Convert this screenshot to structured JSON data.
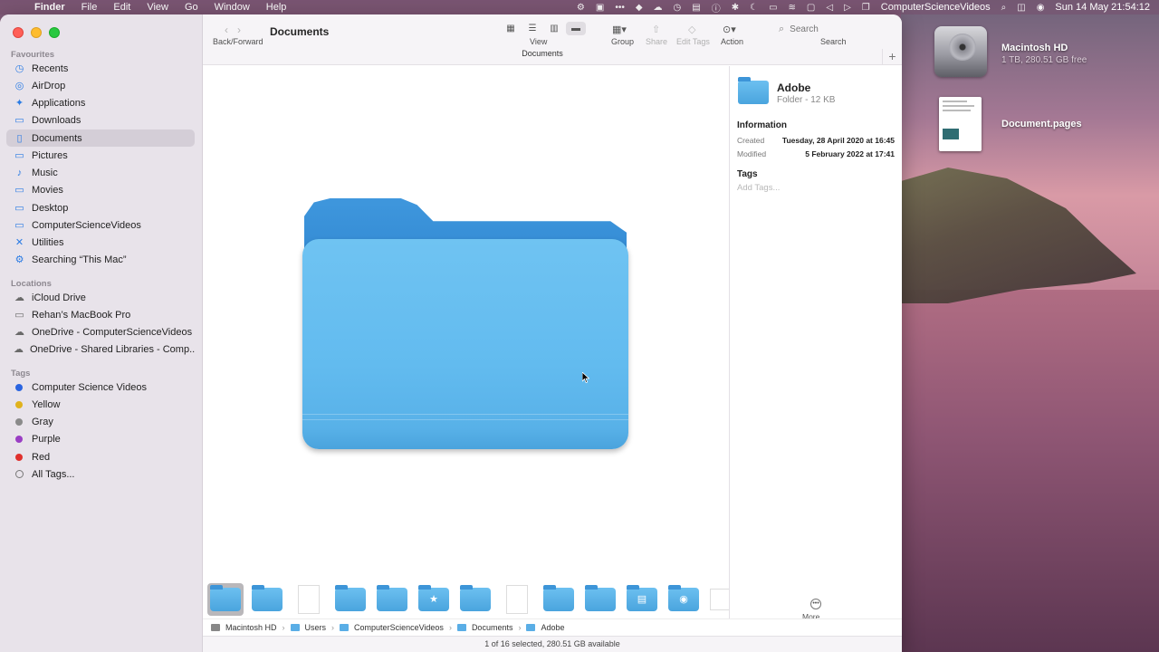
{
  "menubar": {
    "app": "Finder",
    "items": [
      "File",
      "Edit",
      "View",
      "Go",
      "Window",
      "Help"
    ],
    "status_user": "ComputerScienceVideos",
    "datetime": "Sun 14 May  21:54:12"
  },
  "desktop": {
    "hd_name": "Macintosh HD",
    "hd_info": "1 TB, 280.51 GB free",
    "doc_name": "Document.pages"
  },
  "sidebar": {
    "favourites_title": "Favourites",
    "favourites": [
      {
        "label": "Recents",
        "icon": "clock-icon"
      },
      {
        "label": "AirDrop",
        "icon": "airdrop-icon"
      },
      {
        "label": "Applications",
        "icon": "applications-icon"
      },
      {
        "label": "Downloads",
        "icon": "downloads-icon"
      },
      {
        "label": "Documents",
        "icon": "documents-icon"
      },
      {
        "label": "Pictures",
        "icon": "pictures-icon"
      },
      {
        "label": "Music",
        "icon": "music-icon"
      },
      {
        "label": "Movies",
        "icon": "movies-icon"
      },
      {
        "label": "Desktop",
        "icon": "desktop-icon"
      },
      {
        "label": "ComputerScienceVideos",
        "icon": "home-icon"
      },
      {
        "label": "Utilities",
        "icon": "utilities-icon"
      },
      {
        "label": "Searching “This Mac”",
        "icon": "gear-icon"
      }
    ],
    "locations_title": "Locations",
    "locations": [
      {
        "label": "iCloud Drive",
        "icon": "cloud-icon"
      },
      {
        "label": "Rehan’s MacBook Pro",
        "icon": "laptop-icon"
      },
      {
        "label": "OneDrive - ComputerScienceVideos",
        "icon": "cloud-icon"
      },
      {
        "label": "OneDrive - Shared Libraries - Comp...",
        "icon": "cloud-icon"
      }
    ],
    "tags_title": "Tags",
    "tags": [
      {
        "label": "Computer Science Videos",
        "color": "#2a64e0"
      },
      {
        "label": "Yellow",
        "color": "#e0b21c"
      },
      {
        "label": "Gray",
        "color": "#8a8a8a"
      },
      {
        "label": "Purple",
        "color": "#9a3ec4"
      },
      {
        "label": "Red",
        "color": "#e0302d"
      },
      {
        "label": "All Tags...",
        "color": ""
      }
    ]
  },
  "toolbar": {
    "back_forward": "Back/Forward",
    "title": "Documents",
    "view": "View",
    "group": "Group",
    "share": "Share",
    "edit_tags": "Edit Tags",
    "action": "Action",
    "search_placeholder": "Search",
    "search_label": "Search",
    "tab_path": "Documents"
  },
  "preview": {
    "name": "Adobe",
    "kind": "Folder - 12 KB",
    "info_heading": "Information",
    "created_label": "Created",
    "created_value": "Tuesday, 28 April 2020 at 16:45",
    "modified_label": "Modified",
    "modified_value": "5 February 2022 at 17:41",
    "tags_heading": "Tags",
    "add_tags": "Add Tags...",
    "more": "More..."
  },
  "pathbar": [
    "Macintosh HD",
    "Users",
    "ComputerScienceVideos",
    "Documents",
    "Adobe"
  ],
  "status": "1 of 16 selected, 280.51 GB available"
}
